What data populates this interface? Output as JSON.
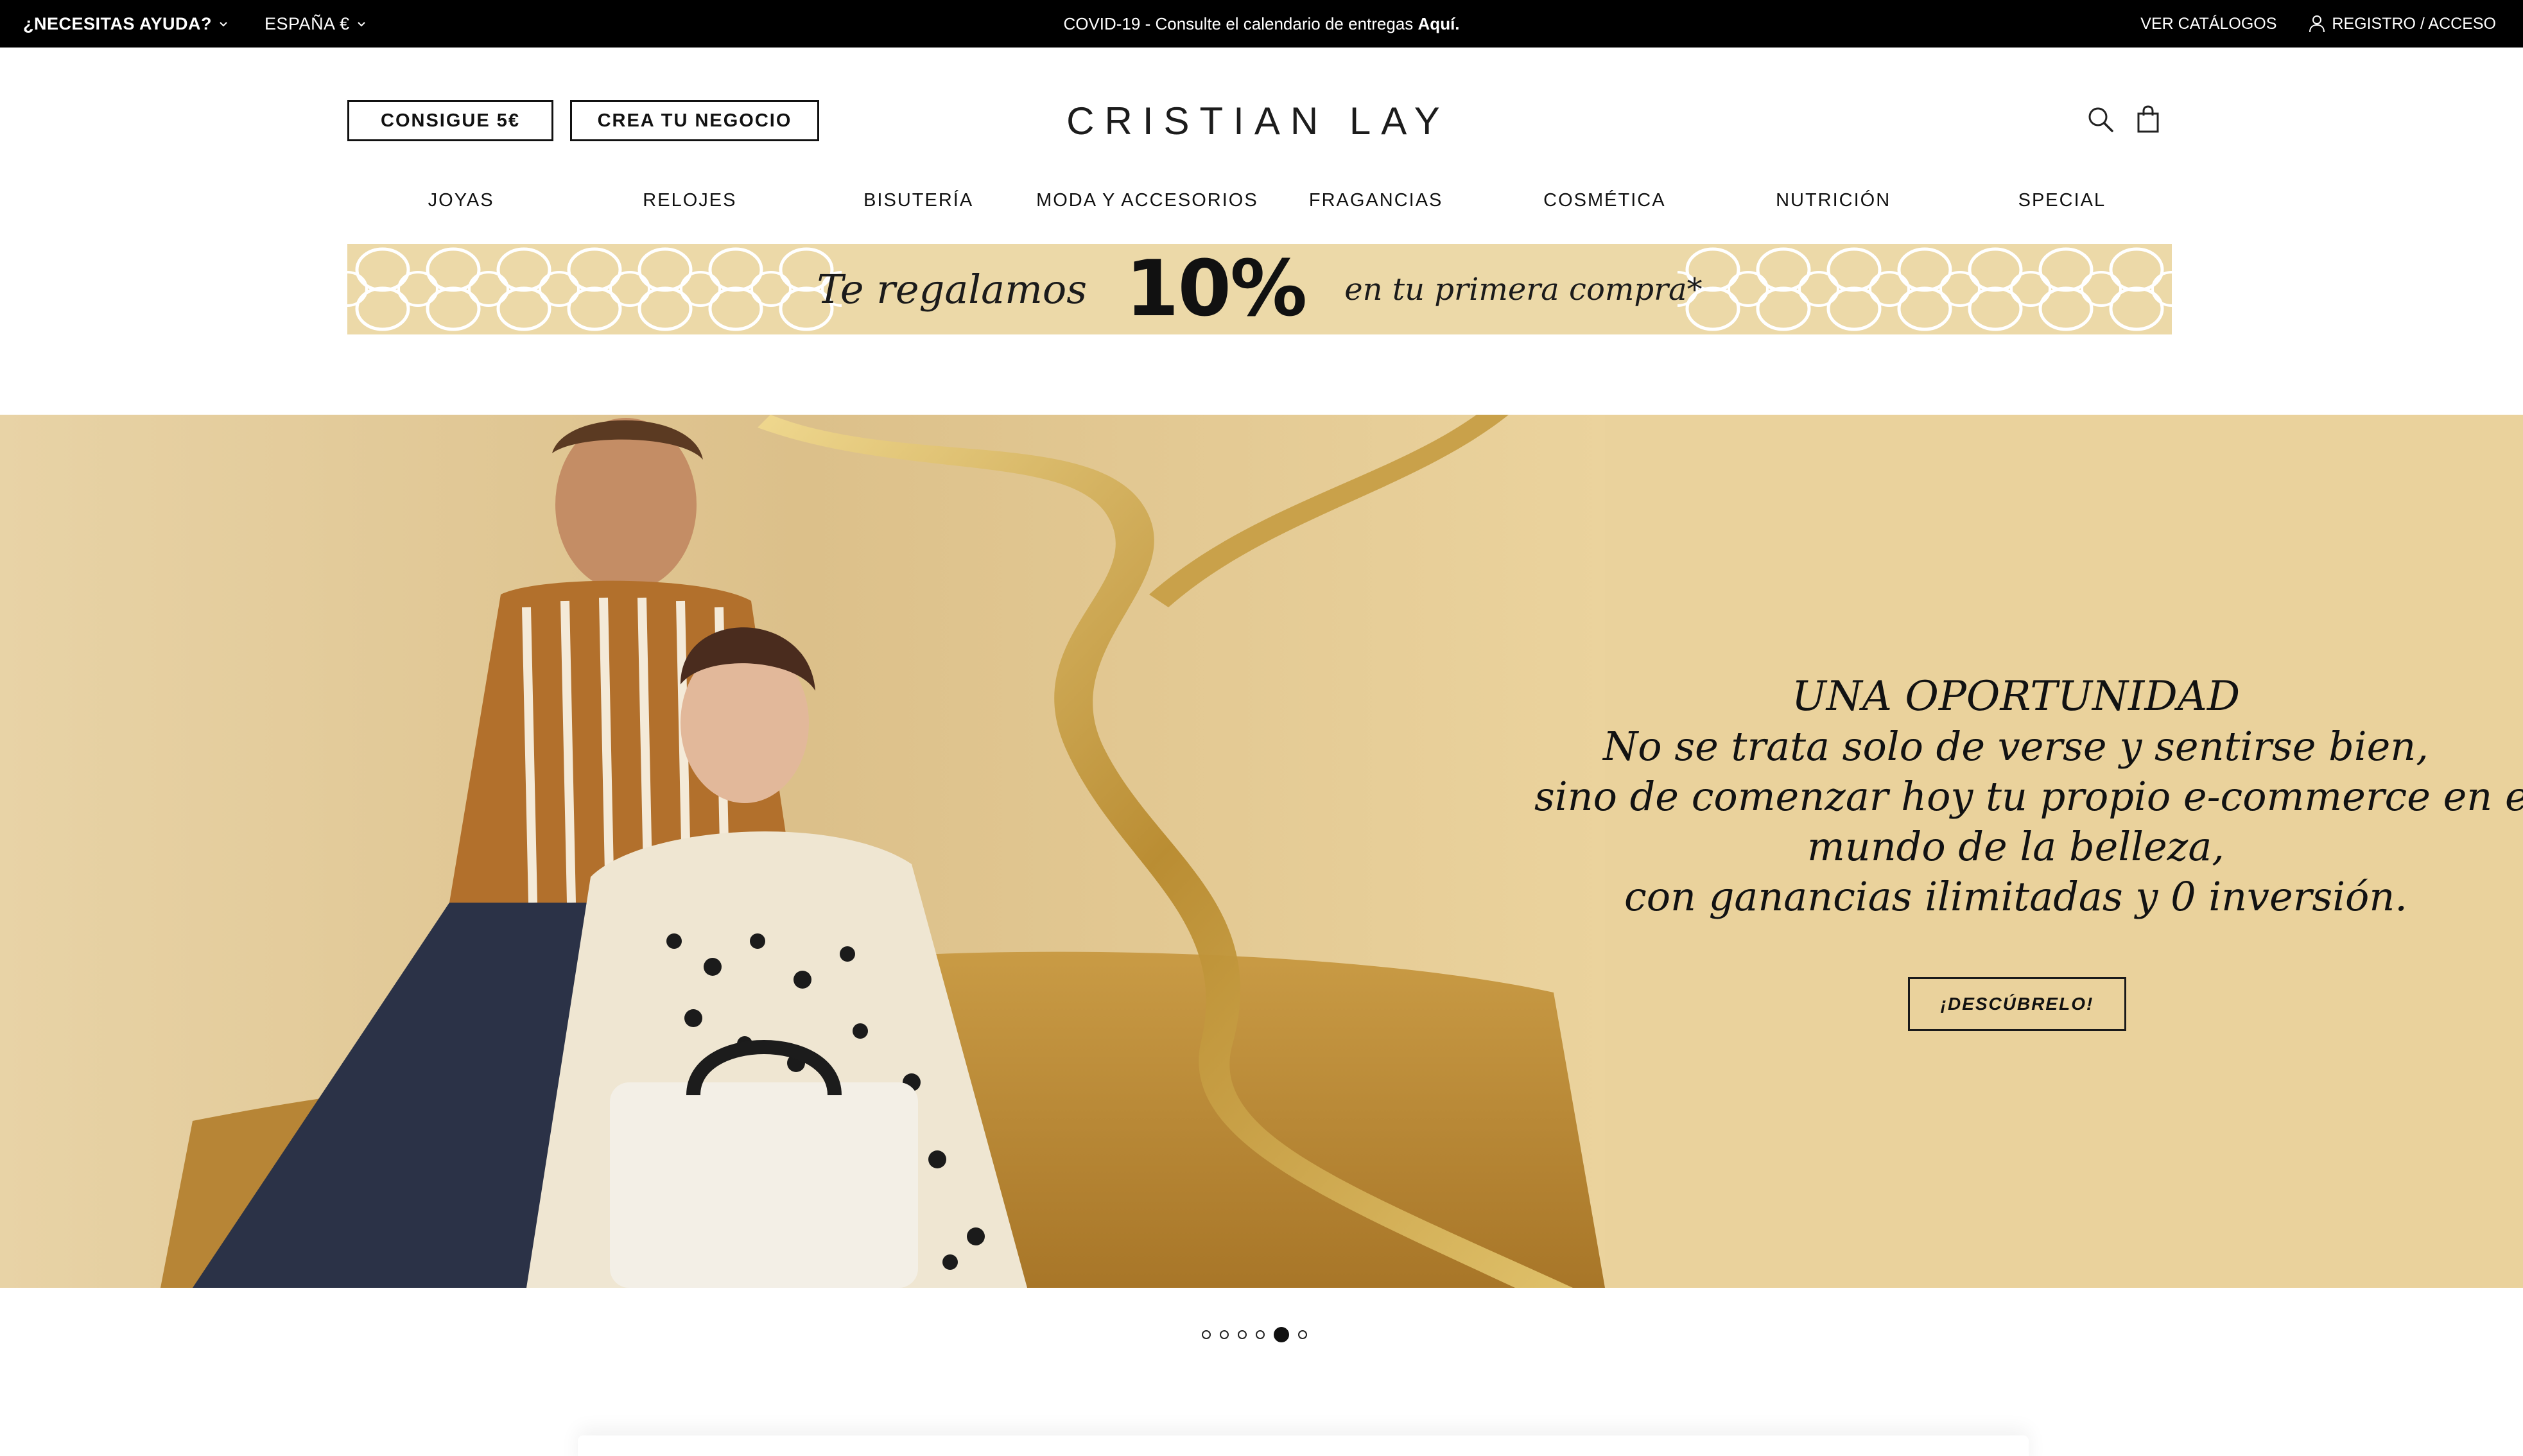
{
  "topbar": {
    "help_label": "¿NECESITAS AYUDA?",
    "country_label": "ESPAÑA €",
    "notice_text": "COVID-19 - Consulte el calendario de entregas ",
    "notice_link": "Aquí.",
    "catalogs_label": "VER CATÁLOGOS",
    "account_label": "REGISTRO / ACCESO"
  },
  "header": {
    "btn_get5": "CONSIGUE 5€",
    "btn_business": "CREA TU NEGOCIO",
    "logo": "CRISTIAN LAY"
  },
  "nav": {
    "items": [
      "JOYAS",
      "RELOJES",
      "BISUTERÍA",
      "MODA Y ACCESORIOS",
      "FRAGANCIAS",
      "COSMÉTICA",
      "NUTRICIÓN",
      "SPECIAL"
    ]
  },
  "promo": {
    "text_before": "Te regalamos",
    "percent": "10%",
    "text_after": "en tu primera compra*"
  },
  "hero": {
    "title": "UNA OPORTUNIDAD",
    "lines": [
      "No se trata solo de verse y sentirse bien,",
      "sino de comenzar hoy tu propio e-commerce en el",
      "mundo de la belleza,",
      "con ganancias ilimitadas y 0 inversión."
    ],
    "cta": "¡DESCÚBRELO!"
  },
  "carousel": {
    "slides": 6,
    "active": 5
  },
  "colors": {
    "topbar": "#000000",
    "promo": "#ecd9a8",
    "hero": "#e9d19a",
    "gold": "#c9a24a"
  }
}
